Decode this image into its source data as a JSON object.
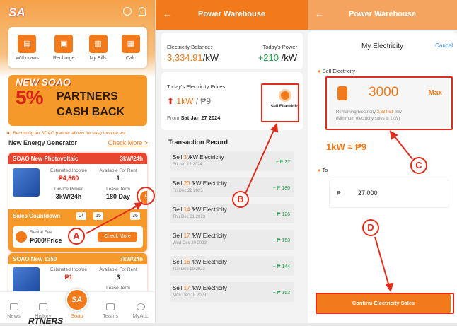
{
  "home": {
    "quick": [
      "Withdraws",
      "Recharge",
      "My Bills",
      "Calc"
    ],
    "banner": {
      "l1": "NEW SOAO",
      "l2": "5%",
      "l3": "PARTNERS",
      "l4": "CASH BACK"
    },
    "notice": "Becoming an SOAO partner allows for easy income ent",
    "section_title": "New Energy Generator",
    "check_more": "Check More >",
    "card1": {
      "name": "SOAO New Photovoltaic",
      "rate": "3kW/24h",
      "est_label": "Estimated Income",
      "est_val": "₱4,860",
      "avail_label": "Available For Rent",
      "avail_val": "1",
      "power_label": "Device Power",
      "power_val": "3kW/24h",
      "lease_label": "Lease Term",
      "lease_val": "180 Day",
      "countdown": "Sales Countdown",
      "t1": "04",
      "t2": "15",
      "t3": "36",
      "fee_label": "Rental Fee",
      "fee_val": "₱600/Price",
      "more_btn": "Check More"
    },
    "card2": {
      "name": "SOAO New 1350",
      "rate": "7kW/24h",
      "est_label": "Estimated Income",
      "est_val": "₱1",
      "avail_label": "Available For Rent",
      "avail_val": "3",
      "lease_label": "Lease Term"
    },
    "tabs": [
      "News",
      "History",
      "Soao",
      "Teams",
      "MyAcc"
    ],
    "footer_peek": "RTNERS"
  },
  "warehouse": {
    "title": "Power Warehouse",
    "bal_label": "Electricity Balance:",
    "bal_val": "3,334.91",
    "bal_unit": "/kW",
    "today_label": "Today's Power",
    "today_val": "+210",
    "today_unit": "/kW",
    "prices_label": "Today's Electricity Prices",
    "price_val": "1kW",
    "price_sep": "/",
    "price_peso": "₱9",
    "from_label": "From",
    "from_date": "Sat Jan 27 2024",
    "sell_btn": "Sell Electricity",
    "tx_title": "Transaction Record",
    "tx": [
      {
        "p": "Sell ",
        "n": "3",
        "s": " /kW Electricity",
        "d": "Fri Jan 12 2024",
        "a": "+ ₱ 27"
      },
      {
        "p": "Sell ",
        "n": "20",
        "s": " /kW Electricity",
        "d": "Fri Dec 22 2023",
        "a": "+ ₱ 180"
      },
      {
        "p": "Sell ",
        "n": "14",
        "s": " /kW Electricity",
        "d": "Thu Dec 21 2023",
        "a": "+ ₱ 126"
      },
      {
        "p": "Sell ",
        "n": "17",
        "s": " /kW Electricity",
        "d": "Wed Dec 20 2023",
        "a": "+ ₱ 153"
      },
      {
        "p": "Sell ",
        "n": "16",
        "s": " /kW Electricity",
        "d": "Tue Dec 19 2023",
        "a": "+ ₱ 144"
      },
      {
        "p": "Sell ",
        "n": "17",
        "s": " /kW Electricity",
        "d": "Mon Dec 18 2023",
        "a": "+ ₱ 153"
      }
    ]
  },
  "sell": {
    "title": "Power Warehouse",
    "modal_title": "My Electricity",
    "cancel": "Cancel",
    "sell_label": "Sell Electricity",
    "amount": "3000",
    "max": "Max",
    "remain_pre": "Remaining Electricity ",
    "remain_val": "3,334.91",
    "remain_suf": " /kW",
    "min_note": "(Minimum electricity sales is 1kW)",
    "rate": "1kW ≈ ₱9",
    "to_label": "To",
    "peso": "₱",
    "to_val": "27,000",
    "confirm": "Confirm Electricity Sales"
  },
  "markers": {
    "a": "A",
    "b": "B",
    "c": "C",
    "d": "D"
  },
  "colors": {
    "accent": "#f27a1a",
    "annotation": "#e12d1d",
    "positive": "#1ea34a"
  }
}
